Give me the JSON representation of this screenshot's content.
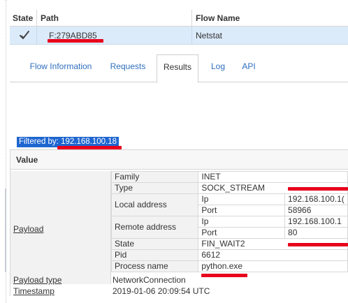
{
  "grid": {
    "headers": {
      "state": "State",
      "path": "Path",
      "flow_name": "Flow Name"
    },
    "row": {
      "path": "F:279ABD85",
      "flow_name": "Netstat"
    }
  },
  "tabs": [
    {
      "label": "Flow Information"
    },
    {
      "label": "Requests"
    },
    {
      "label": "Results",
      "active": true
    },
    {
      "label": "Log"
    },
    {
      "label": "API"
    }
  ],
  "filter": {
    "text": "Filtered by: 192.168.100.18"
  },
  "panel": {
    "header": "Value",
    "payload_label": "Payload",
    "rows": {
      "family": {
        "label": "Family",
        "value": "INET"
      },
      "type": {
        "label": "Type",
        "value": "SOCK_STREAM"
      },
      "local_address": {
        "label": "Local address",
        "ip_label": "Ip",
        "ip_value": "192.168.100.1(",
        "port_label": "Port",
        "port_value": "58966"
      },
      "remote_address": {
        "label": "Remote address",
        "ip_label": "Ip",
        "ip_value": "192.168.100.1",
        "port_label": "Port",
        "port_value": "80"
      },
      "state": {
        "label": "State",
        "value": "FIN_WAIT2"
      },
      "pid": {
        "label": "Pid",
        "value": "6612"
      },
      "process_name": {
        "label": "Process name",
        "value": "python.exe"
      }
    },
    "payload_type": {
      "label": "Payload type",
      "value": "NetworkConnection"
    },
    "timestamp": {
      "label": "Timestamp",
      "value": "2019-01-06 20:09:54 UTC"
    }
  },
  "colors": {
    "selected_row": "#dcebfa",
    "link": "#2f6fbf",
    "filter_bg": "#1e66d0",
    "redaction": "#e8001c"
  },
  "icons": {
    "state": "check-icon"
  }
}
